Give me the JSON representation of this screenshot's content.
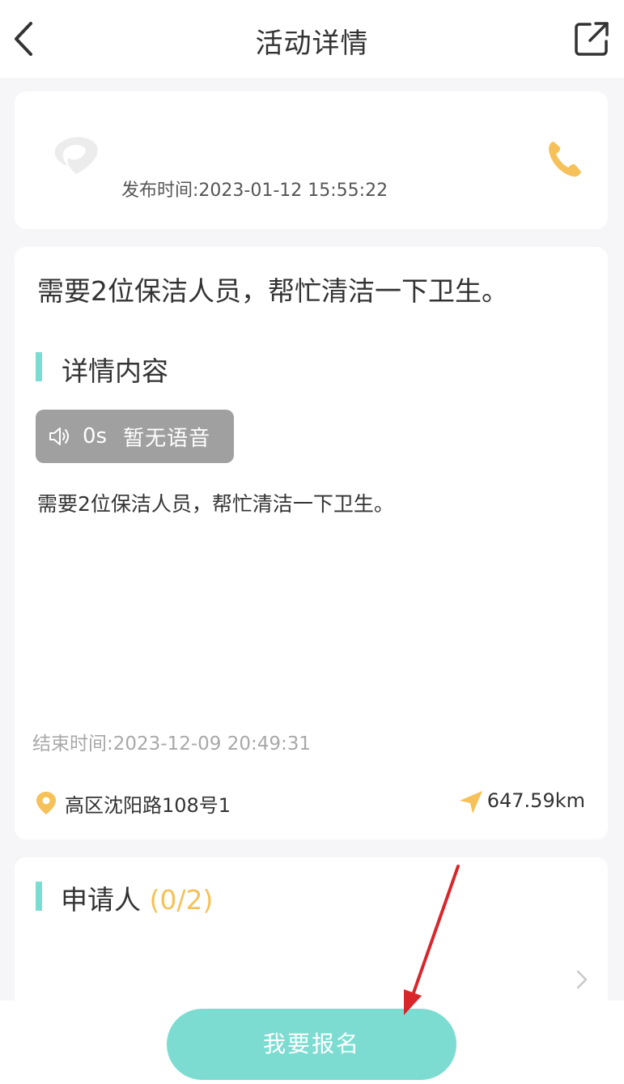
{
  "header": {
    "title": "活动详情",
    "back_icon": "chevron-left-icon",
    "share_icon": "share-external-icon"
  },
  "publisher_card": {
    "publish_time": "发布时间:2023-01-12 15:55:22",
    "phone_icon": "phone-icon"
  },
  "detail_card": {
    "headline": "需要2位保洁人员，帮忙清洁一下卫生。",
    "section_title": "详情内容",
    "voice": {
      "duration": "0s",
      "message": "暂无语音",
      "icon": "speaker-icon"
    },
    "description": "需要2位保洁人员，帮忙清洁一下卫生。",
    "end_time": "结束时间:2023-12-09 20:49:31",
    "address": "高区沈阳路108号1",
    "distance": "647.59km"
  },
  "applicants_card": {
    "title": "申请人",
    "count": "(0/2)"
  },
  "footer": {
    "signup_label": "我要报名"
  },
  "colors": {
    "accent": "#7ddcd1",
    "highlight": "#f5c158",
    "annotation_arrow": "#d9262b"
  }
}
